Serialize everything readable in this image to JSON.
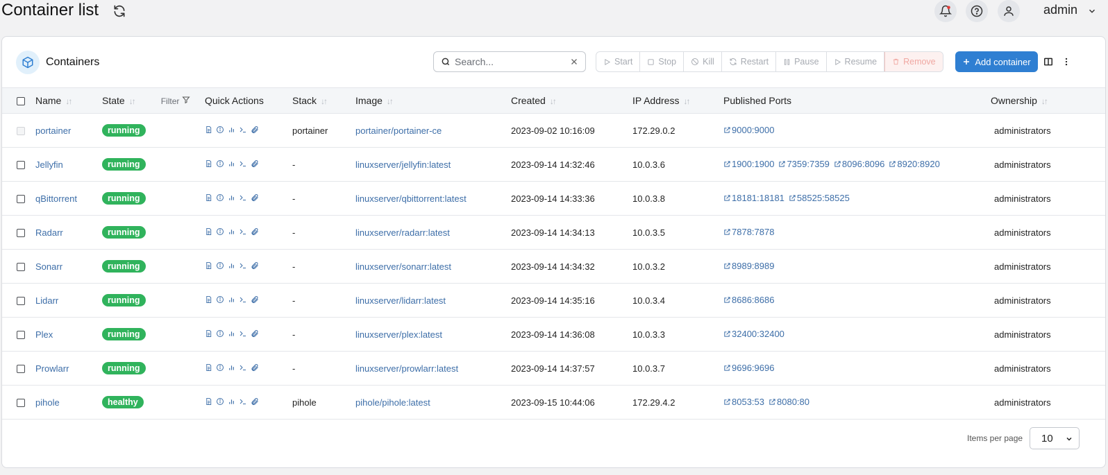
{
  "header": {
    "title": "Container list",
    "user": "admin"
  },
  "card": {
    "title": "Containers",
    "search_placeholder": "Search...",
    "actions": {
      "start": "Start",
      "stop": "Stop",
      "kill": "Kill",
      "restart": "Restart",
      "pause": "Pause",
      "resume": "Resume",
      "remove": "Remove",
      "add": "Add container"
    }
  },
  "columns": {
    "name": "Name",
    "state": "State",
    "filter": "Filter",
    "quick_actions": "Quick Actions",
    "stack": "Stack",
    "image": "Image",
    "created": "Created",
    "ip": "IP Address",
    "ports": "Published Ports",
    "ownership": "Ownership"
  },
  "rows": [
    {
      "name": "portainer",
      "state": "running",
      "stack": "portainer",
      "image": "portainer/portainer-ce",
      "created": "2023-09-02 10:16:09",
      "ip": "172.29.0.2",
      "ports": [
        "9000:9000"
      ],
      "ownership": "administrators",
      "checkbox_disabled": true
    },
    {
      "name": "Jellyfin",
      "state": "running",
      "stack": "-",
      "image": "linuxserver/jellyfin:latest",
      "created": "2023-09-14 14:32:46",
      "ip": "10.0.3.6",
      "ports": [
        "1900:1900",
        "7359:7359",
        "8096:8096",
        "8920:8920"
      ],
      "ownership": "administrators"
    },
    {
      "name": "qBittorrent",
      "state": "running",
      "stack": "-",
      "image": "linuxserver/qbittorrent:latest",
      "created": "2023-09-14 14:33:36",
      "ip": "10.0.3.8",
      "ports": [
        "18181:18181",
        "58525:58525"
      ],
      "ownership": "administrators"
    },
    {
      "name": "Radarr",
      "state": "running",
      "stack": "-",
      "image": "linuxserver/radarr:latest",
      "created": "2023-09-14 14:34:13",
      "ip": "10.0.3.5",
      "ports": [
        "7878:7878"
      ],
      "ownership": "administrators"
    },
    {
      "name": "Sonarr",
      "state": "running",
      "stack": "-",
      "image": "linuxserver/sonarr:latest",
      "created": "2023-09-14 14:34:32",
      "ip": "10.0.3.2",
      "ports": [
        "8989:8989"
      ],
      "ownership": "administrators"
    },
    {
      "name": "Lidarr",
      "state": "running",
      "stack": "-",
      "image": "linuxserver/lidarr:latest",
      "created": "2023-09-14 14:35:16",
      "ip": "10.0.3.4",
      "ports": [
        "8686:8686"
      ],
      "ownership": "administrators"
    },
    {
      "name": "Plex",
      "state": "running",
      "stack": "-",
      "image": "linuxserver/plex:latest",
      "created": "2023-09-14 14:36:08",
      "ip": "10.0.3.3",
      "ports": [
        "32400:32400"
      ],
      "ownership": "administrators"
    },
    {
      "name": "Prowlarr",
      "state": "running",
      "stack": "-",
      "image": "linuxserver/prowlarr:latest",
      "created": "2023-09-14 14:37:57",
      "ip": "10.0.3.7",
      "ports": [
        "9696:9696"
      ],
      "ownership": "administrators"
    },
    {
      "name": "pihole",
      "state": "healthy",
      "stack": "pihole",
      "image": "pihole/pihole:latest",
      "created": "2023-09-15 10:44:06",
      "ip": "172.29.4.2",
      "ports": [
        "8053:53",
        "8080:80"
      ],
      "ownership": "administrators"
    }
  ],
  "footer": {
    "items_per_page_label": "Items per page",
    "items_per_page": "10"
  },
  "colors": {
    "primary": "#2f7fd2",
    "link": "#3d6ea8",
    "badge_green": "#30b35c"
  }
}
